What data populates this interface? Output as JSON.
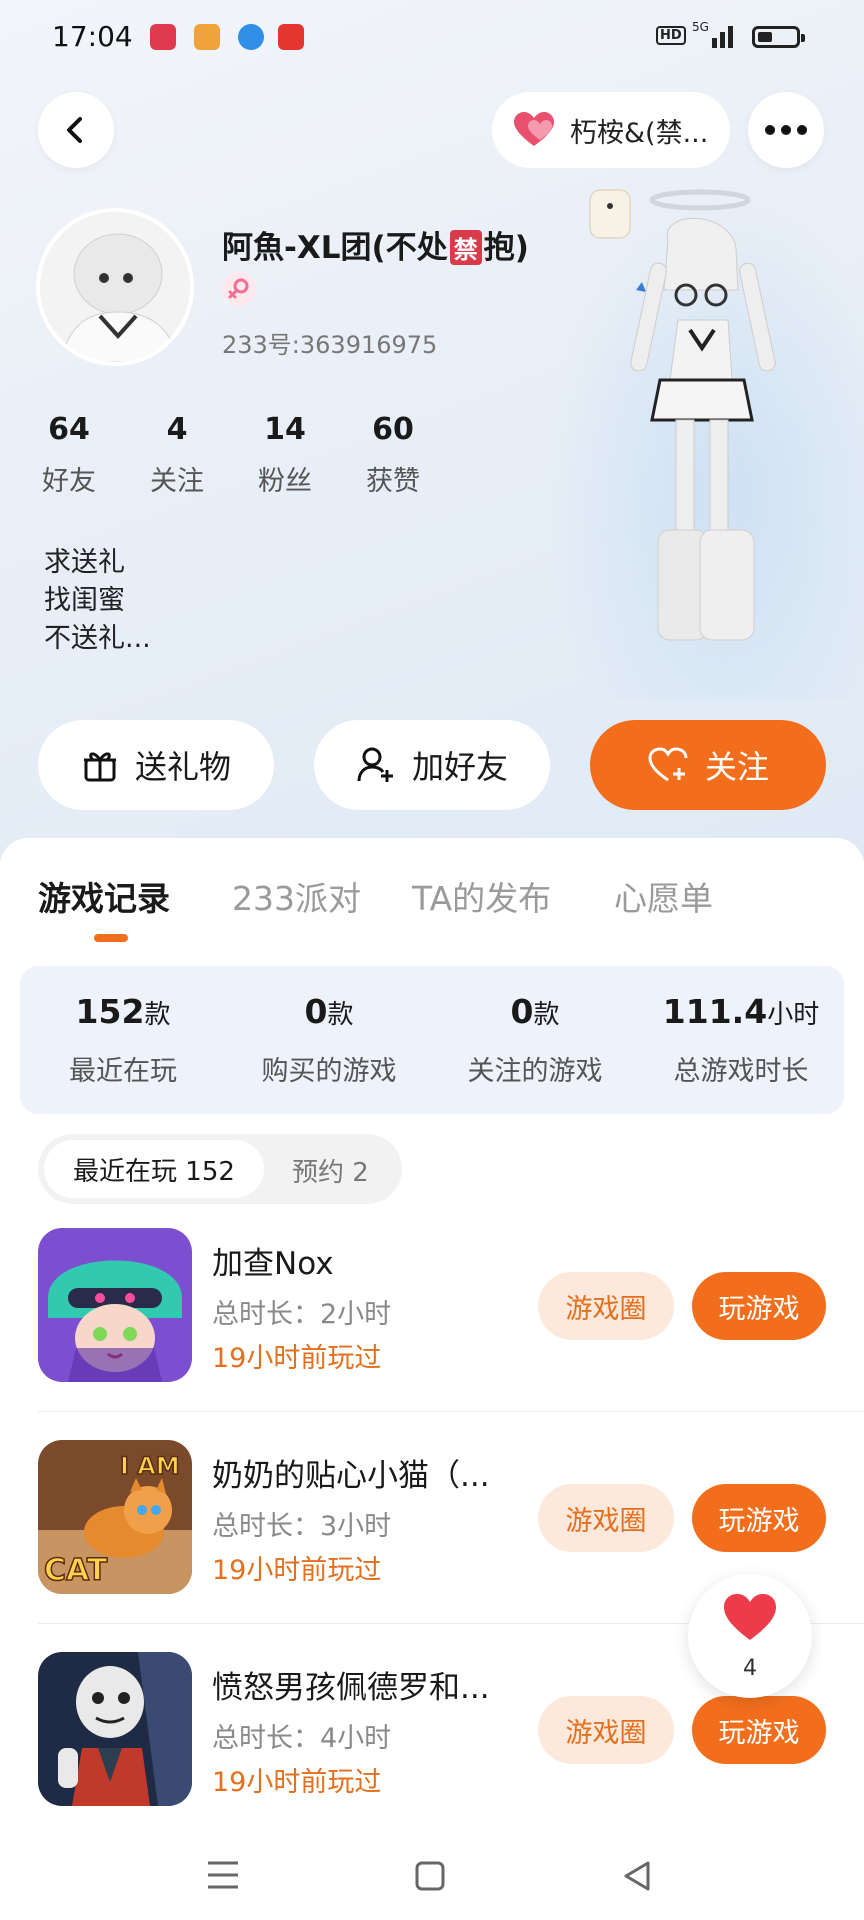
{
  "status_bar": {
    "time": "17:04",
    "network": "HD",
    "signal": "5G"
  },
  "header": {
    "back_icon": "back-arrow-icon",
    "pill_label": "朽桉&(禁...",
    "more_icon": "more-dots-icon"
  },
  "profile": {
    "name_prefix": "阿魚-XL团(不处",
    "name_badge": "禁",
    "name_suffix": "抱)",
    "gender": "female",
    "uid": "233号:363916975",
    "stats": [
      {
        "value": "64",
        "label": "好友"
      },
      {
        "value": "4",
        "label": "关注"
      },
      {
        "value": "14",
        "label": "粉丝"
      },
      {
        "value": "60",
        "label": "获赞"
      }
    ],
    "bio": [
      "求送礼",
      "找闺蜜",
      "不送礼..."
    ]
  },
  "actions": {
    "gift": "送礼物",
    "add_friend": "加好友",
    "follow": "关注"
  },
  "tabs": [
    "游戏记录",
    "233派对",
    "TA的发布",
    "心愿单"
  ],
  "summary": [
    {
      "value": "152",
      "unit": "款",
      "label": "最近在玩"
    },
    {
      "value": "0",
      "unit": "款",
      "label": "购买的游戏"
    },
    {
      "value": "0",
      "unit": "款",
      "label": "关注的游戏"
    },
    {
      "value": "111.4",
      "unit": "小时",
      "label": "总游戏时长"
    }
  ],
  "segments": {
    "recent": "最近在玩 152",
    "reserved": "预约 2"
  },
  "games": [
    {
      "title": "加查Nox",
      "duration": "总时长：2小时",
      "last": "19小时前玩过",
      "circle": "游戏圈",
      "play": "玩游戏"
    },
    {
      "title": "奶奶的贴心小猫（...",
      "duration": "总时长：3小时",
      "last": "19小时前玩过",
      "circle": "游戏圈",
      "play": "玩游戏",
      "icon_text": [
        "I AM",
        "CAT"
      ]
    },
    {
      "title": "愤怒男孩佩德罗和...",
      "duration": "总时长：4小时",
      "last": "19小时前玩过",
      "circle": "游戏圈",
      "play": "玩游戏"
    }
  ],
  "floating_like": {
    "count": "4"
  },
  "colors": {
    "accent": "#f26e1d",
    "accent_soft": "#fde8dc",
    "accent_text": "#e2701e"
  }
}
